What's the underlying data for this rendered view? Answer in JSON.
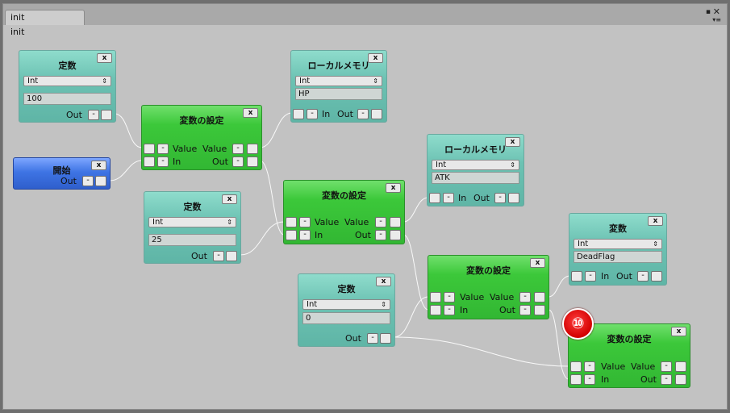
{
  "window": {
    "tab_label": "init",
    "canvas_title": "init",
    "controls": {
      "maximize": "▪",
      "close": "✕",
      "menu": "▾≡"
    }
  },
  "badge": "⑩",
  "nodes": {
    "const_100": {
      "title": "定数",
      "close": "x",
      "type": "Int",
      "value": "100",
      "out": "Out",
      "minus": "-"
    },
    "start": {
      "title": "開始",
      "close": "x",
      "out": "Out",
      "minus": "-"
    },
    "set_var_1": {
      "title": "変数の設定",
      "close": "x",
      "value_in": "Value",
      "value_out": "Value",
      "in": "In",
      "out": "Out",
      "minus": "-"
    },
    "local_hp": {
      "title": "ローカルメモリ",
      "close": "x",
      "type": "Int",
      "value": "HP",
      "in": "In",
      "out": "Out",
      "minus": "-"
    },
    "const_25": {
      "title": "定数",
      "close": "x",
      "type": "Int",
      "value": "25",
      "out": "Out",
      "minus": "-"
    },
    "set_var_2": {
      "title": "変数の設定",
      "close": "x",
      "value_in": "Value",
      "value_out": "Value",
      "in": "In",
      "out": "Out",
      "minus": "-"
    },
    "local_atk": {
      "title": "ローカルメモリ",
      "close": "x",
      "type": "Int",
      "value": "ATK",
      "in": "In",
      "out": "Out",
      "minus": "-"
    },
    "const_0": {
      "title": "定数",
      "close": "x",
      "type": "Int",
      "value": "0",
      "out": "Out",
      "minus": "-"
    },
    "set_var_3": {
      "title": "変数の設定",
      "close": "x",
      "value_in": "Value",
      "value_out": "Value",
      "in": "In",
      "out": "Out",
      "minus": "-"
    },
    "var_deadflag": {
      "title": "変数",
      "close": "x",
      "type": "Int",
      "value": "DeadFlag",
      "in": "In",
      "out": "Out",
      "minus": "-"
    },
    "set_var_4": {
      "title": "変数の設定",
      "close": "x",
      "value_in": "Value",
      "value_out": "Value",
      "in": "In",
      "out": "Out",
      "minus": "-"
    }
  },
  "colors": {
    "canvas": "#c2c2c2",
    "teal_node": "#6cc2b3",
    "green_node": "#3cc83a",
    "blue_node": "#3e74e4",
    "wire": "#ffffff",
    "badge": "#d20000"
  }
}
